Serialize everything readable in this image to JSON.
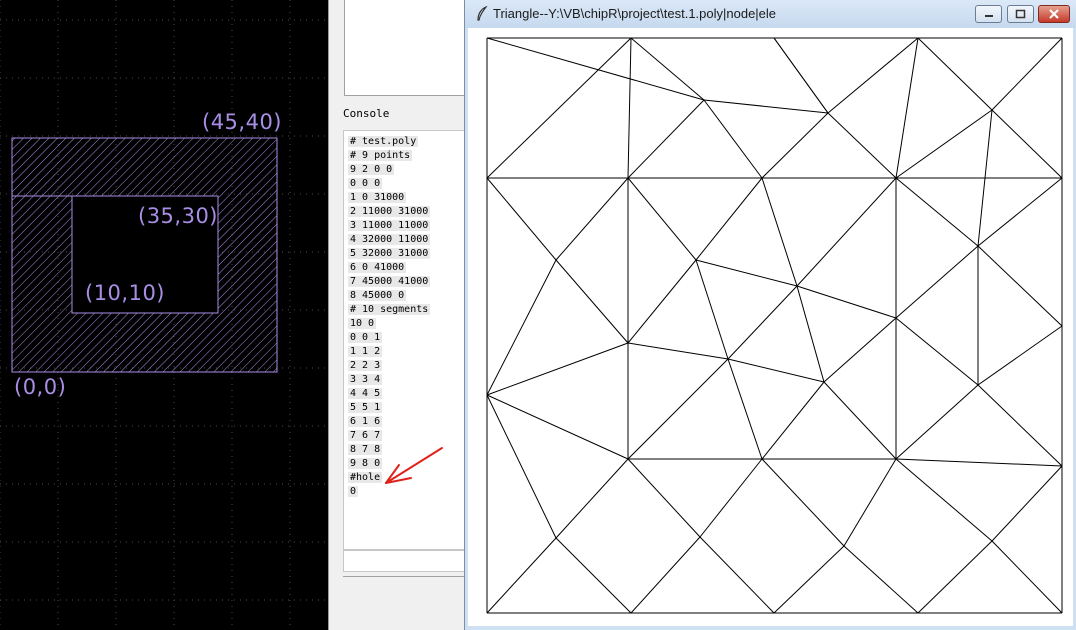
{
  "cad_view": {
    "labels": {
      "outer_top_right": "(45,40)",
      "inner_top_right": "(35,30)",
      "inner_bottom_left": "(10,10)",
      "origin": "(0,0)"
    },
    "colors": {
      "background": "#000000",
      "geometry": "#a98ee6",
      "grid": "#4a4a4a"
    }
  },
  "console_panel": {
    "label": "Console",
    "lines": [
      "# test.poly",
      "# 9 points",
      "9 2 0 0",
      "0 0 0",
      "1 0 31000",
      "2 11000 31000",
      "3 11000 11000",
      "4 32000 11000",
      "5 32000 31000",
      "6 0 41000",
      "7 45000 41000",
      "8 45000 0",
      "# 10 segments",
      "10 0",
      "0 0 1",
      "1 1 2",
      "2 2 3",
      "3 3 4",
      "4 4 5",
      "5 5 1",
      "6 1 6",
      "7 6 7",
      "8 7 8",
      "9 8 0",
      "#hole",
      "0"
    ],
    "annotation_arrow_color": "#e0231a"
  },
  "triangle_window": {
    "title": "Triangle--Y:\\VB\\chipR\\project\\test.1.poly|node|ele",
    "icons": {
      "app": "feather-icon",
      "minimize": "minimize-icon",
      "maximize": "maximize-icon",
      "close": "close-icon"
    }
  }
}
